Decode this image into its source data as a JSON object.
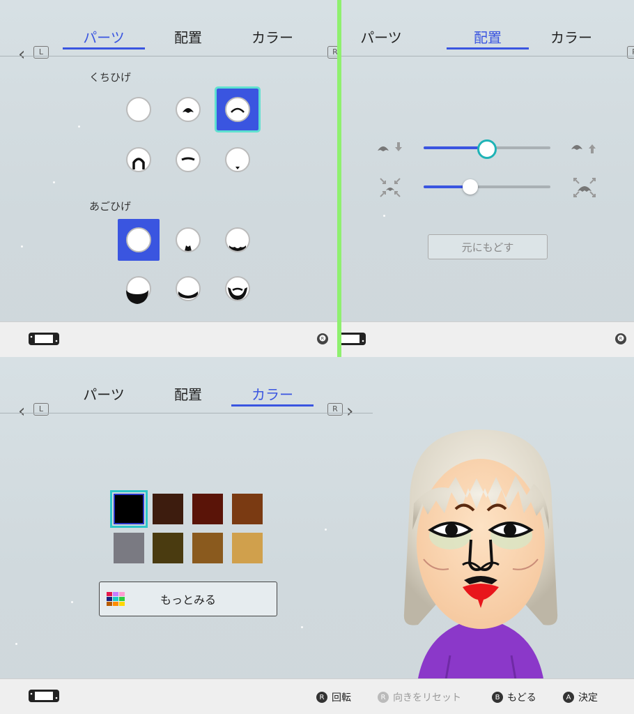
{
  "tabs": {
    "parts": "パーツ",
    "position": "配置",
    "color": "カラー"
  },
  "buttons": {
    "L": "L",
    "R": "R"
  },
  "parts_panel": {
    "section_mustache": "くちひげ",
    "section_beard": "あごひげ"
  },
  "position_panel": {
    "reset_label": "元にもどす",
    "slider_vertical_value": 0.5,
    "slider_size_value": 0.37
  },
  "color_panel": {
    "swatches": [
      "#000000",
      "#3d1c0e",
      "#5a1408",
      "#7a3a12",
      "#7a7a82",
      "#4a3b10",
      "#8a5a1e",
      "#d0a04c"
    ],
    "more_label": "もっとみる",
    "more_grid_colors": [
      "#e6194b",
      "#c77dff",
      "#ff9bd2",
      "#1a237e",
      "#1ec8c8",
      "#2ecc40",
      "#b85c00",
      "#ff8c00",
      "#ffd700"
    ]
  },
  "footer": {
    "rotate_badge": "R",
    "rotate_label": "回転",
    "reset_facing_label": "向きをリセット",
    "back_badge": "B",
    "back_label": "もどる",
    "confirm_badge": "A",
    "confirm_label": "決定"
  },
  "colors": {
    "accent": "#3a55e0",
    "selection": "#5fe0d0",
    "divider": "#8ff06f"
  }
}
